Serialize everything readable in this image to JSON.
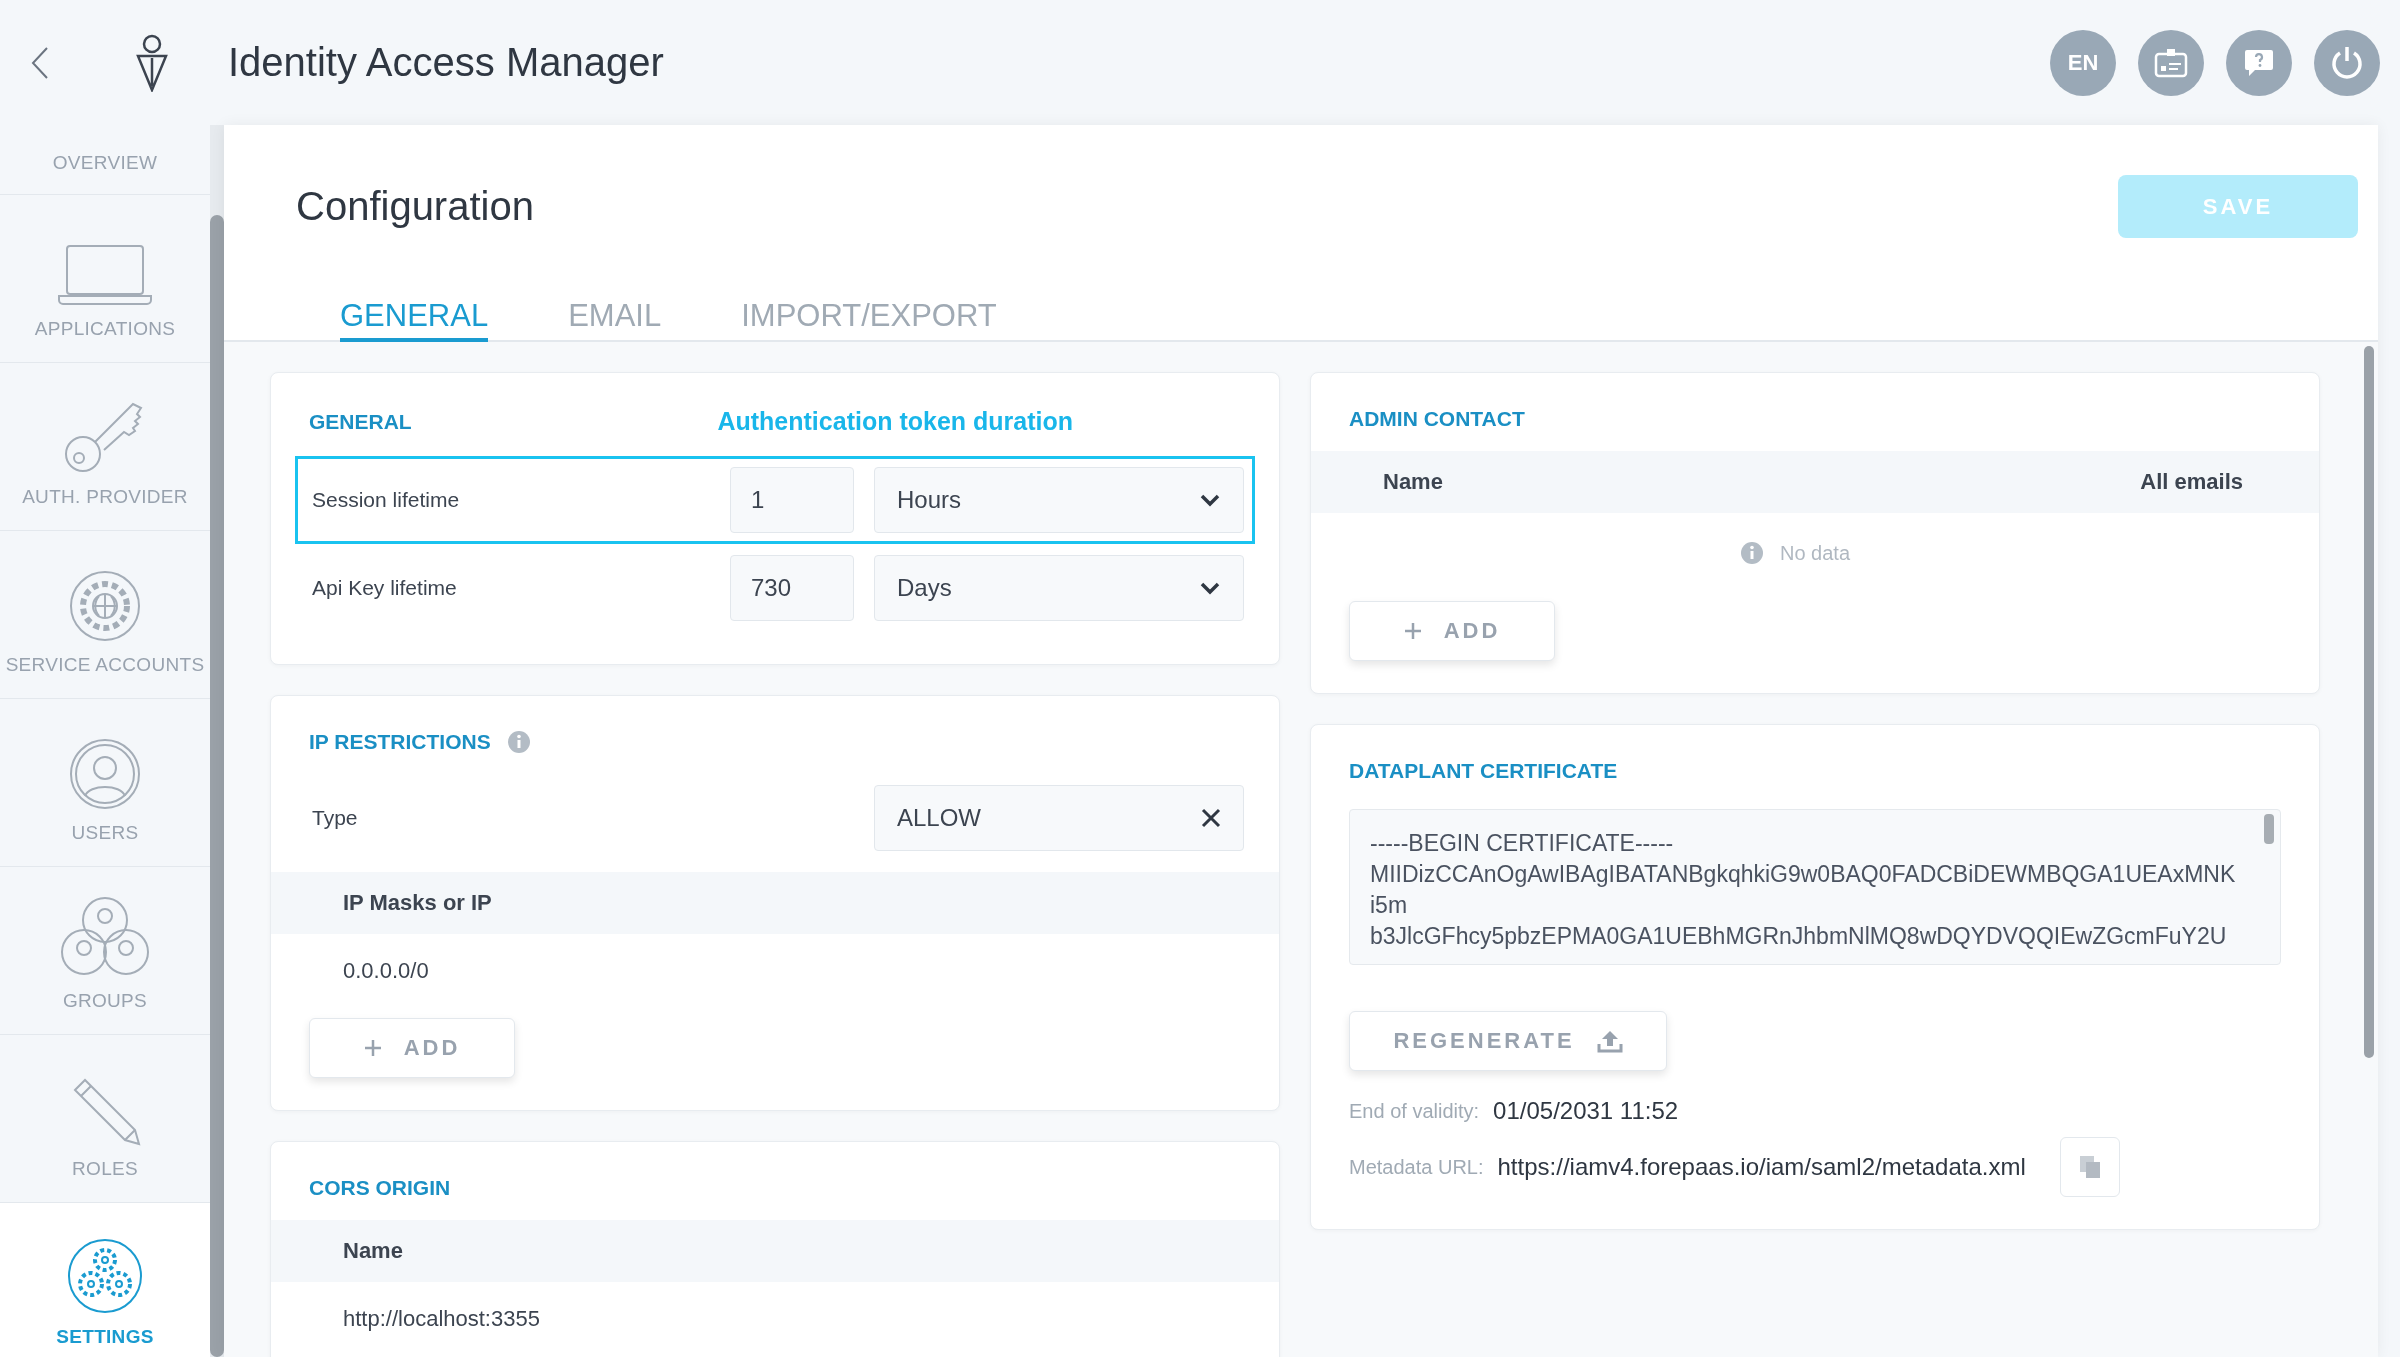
{
  "header": {
    "title": "Identity Access Manager",
    "language": "EN"
  },
  "sidebar": {
    "items": [
      {
        "label": "OVERVIEW",
        "selected": false
      },
      {
        "label": "APPLICATIONS",
        "kind": "laptop",
        "selected": false
      },
      {
        "label": "AUTH. PROVIDER",
        "kind": "key",
        "selected": false
      },
      {
        "label": "SERVICE ACCOUNTS",
        "kind": "gear",
        "selected": false
      },
      {
        "label": "USERS",
        "kind": "user",
        "selected": false
      },
      {
        "label": "GROUPS",
        "kind": "group",
        "selected": false
      },
      {
        "label": "ROLES",
        "kind": "pencil",
        "selected": false
      },
      {
        "label": "SETTINGS",
        "kind": "gears",
        "selected": true
      }
    ]
  },
  "page": {
    "title": "Configuration",
    "save_button": {
      "label": "SAVE",
      "disabled": true
    }
  },
  "tabs": [
    {
      "label": "GENERAL",
      "selected": true
    },
    {
      "label": "EMAIL",
      "selected": false
    },
    {
      "label": "IMPORT/EXPORT",
      "selected": false
    }
  ],
  "general": {
    "title": "GENERAL",
    "annotation": "Authentication token duration",
    "rows": [
      {
        "label": "Session lifetime",
        "value": "1",
        "unit": "Hours",
        "highlighted": true
      },
      {
        "label": "Api Key lifetime",
        "value": "730",
        "unit": "Days",
        "highlighted": false
      }
    ]
  },
  "ip_restrictions": {
    "title": "IP RESTRICTIONS",
    "type_label": "Type",
    "type_value": "ALLOW",
    "columns": [
      "IP Masks or IP"
    ],
    "rows": [
      "0.0.0.0/0"
    ],
    "add_button": "ADD"
  },
  "cors_origin": {
    "title": "CORS ORIGIN",
    "columns": [
      "Name"
    ],
    "rows": [
      "http://localhost:3355"
    ]
  },
  "admin_contact": {
    "title": "ADMIN CONTACT",
    "columns": [
      "Name",
      "All emails"
    ],
    "empty_text": "No data",
    "add_button": "ADD"
  },
  "certificate": {
    "title": "DATAPLANT CERTIFICATE",
    "lines": [
      "-----BEGIN CERTIFICATE-----",
      "MIIDizCCAnOgAwIBAgIBATANBgkqhkiG9w0BAQ0FADCBiDEWMBQGA1UEAxMNK",
      "i5m",
      "b3JlcGFhcy5pbzEPMA0GA1UEBhMGRnJhbmNlMQ8wDQYDVQQIEwZGcmFuY2U"
    ],
    "regenerate_button": "REGENERATE",
    "validity_label": "End of validity:",
    "validity_value": "01/05/2031 11:52",
    "metadata_label": "Metadata URL:",
    "metadata_url": "https://iamv4.forepaas.io/iam/saml2/metadata.xml"
  }
}
